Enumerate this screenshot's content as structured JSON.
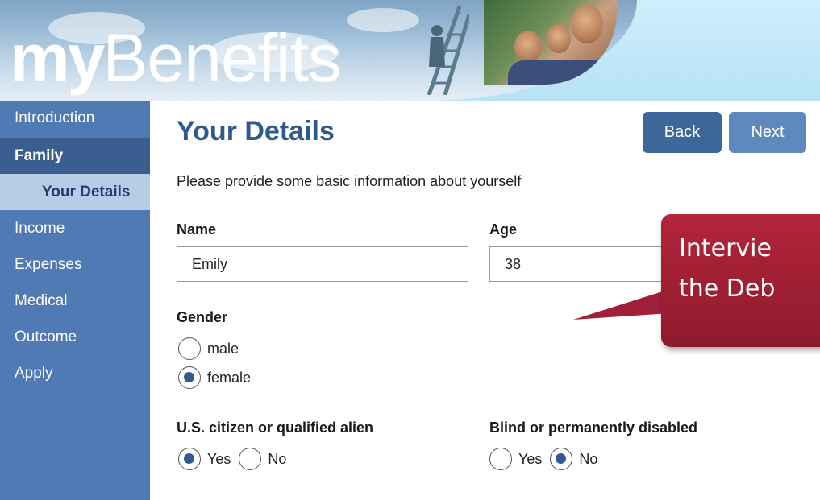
{
  "brand": {
    "logo_my": "my",
    "logo_benefits": "Benefits"
  },
  "sidebar": {
    "items": [
      {
        "label": "Introduction"
      },
      {
        "label": "Family"
      },
      {
        "label": "Your Details"
      },
      {
        "label": "Income"
      },
      {
        "label": "Expenses"
      },
      {
        "label": "Medical"
      },
      {
        "label": "Outcome"
      },
      {
        "label": "Apply"
      }
    ]
  },
  "page": {
    "title": "Your Details",
    "intro": "Please provide some basic information about yourself",
    "back_label": "Back",
    "next_label": "Next"
  },
  "form": {
    "name_label": "Name",
    "name_value": "Emily",
    "age_label": "Age",
    "age_value": "38",
    "gender_label": "Gender",
    "gender_options": [
      "male",
      "female"
    ],
    "gender_selected": "female",
    "citizen_label": "U.S. citizen or qualified alien",
    "citizen_yes": "Yes",
    "citizen_no": "No",
    "citizen_selected": "Yes",
    "disabled_label": "Blind or permanently disabled",
    "disabled_yes": "Yes",
    "disabled_no": "No",
    "disabled_selected": "No"
  },
  "callout": {
    "line1": "Intervie",
    "line2": "the Deb"
  },
  "colors": {
    "sidebar": "#4f7ab3",
    "sidebar_active": "#3a5e8f",
    "sidebar_sub": "#b7cde6",
    "title": "#2f5a8e",
    "callout": "#a0203a",
    "header_sky": "#b6e3f6"
  }
}
